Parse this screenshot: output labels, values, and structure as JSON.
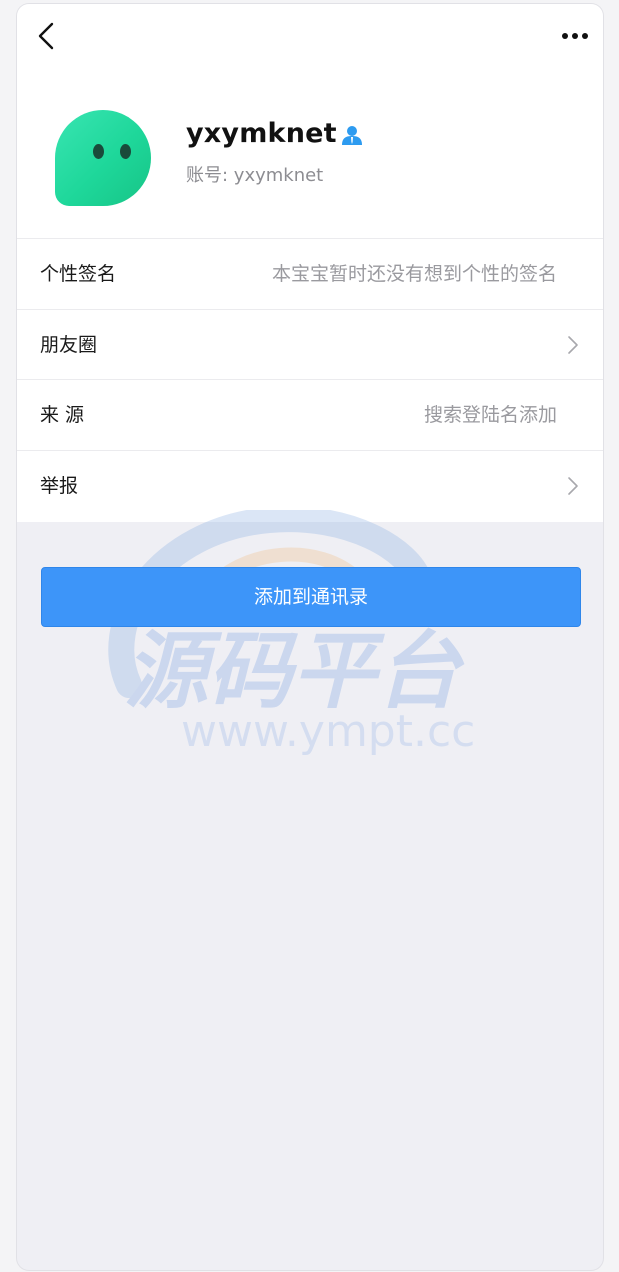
{
  "header": {
    "back_icon": "chevron-left-icon",
    "more_icon": "more-horizontal-icon"
  },
  "profile": {
    "avatar_icon": "chat-bubble-face-avatar",
    "nickname": "yxymknet",
    "account": "账号: yxymknet",
    "badge_icon": "user-icon",
    "badge_color": "#2d9bf0"
  },
  "rows": [
    {
      "label": "个性签名",
      "value": "本宝宝暂时还没有想到个性的签名"
    },
    {
      "label": "朋友圈",
      "value": ""
    },
    {
      "label": "来 源",
      "value": "搜索登陆名添加"
    },
    {
      "label": "举报",
      "value": ""
    }
  ],
  "watermark": {
    "title": "源码平台",
    "url": "www.ympt.cc"
  },
  "add_button": {
    "label": "添加到通讯录",
    "color": "#3d95f9"
  }
}
